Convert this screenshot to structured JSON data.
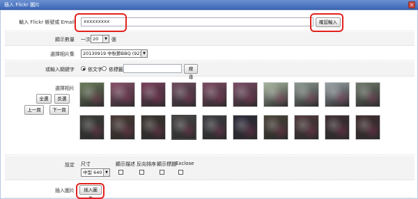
{
  "window": {
    "title": "插入 Flickr 圖片",
    "close_glyph": "×"
  },
  "account": {
    "label": "輸入 Flickr 帳號或 Email",
    "value": "xxxxxxxxx",
    "confirm_label": "確認輸入"
  },
  "count": {
    "label": "顯示數量",
    "prefix": "一次",
    "value": "20",
    "suffix": "張"
  },
  "album": {
    "label": "選擇相片集",
    "value": "20130919 中秋節BBQ (92)"
  },
  "keyword": {
    "label": "或輸入關鍵字",
    "option_full": "依文字",
    "option_tag": "依標籤",
    "search_label": "搜尋",
    "selected": "依文字"
  },
  "photos": {
    "label": "選擇相片",
    "select_all": "全選",
    "invert": "反選",
    "prev": "上一頁",
    "next": "下一頁",
    "selected_index": 13,
    "thumbs": [
      {
        "tone": "#6b7b5a"
      },
      {
        "tone": "#8a4f6a"
      },
      {
        "tone": "#7a3e5b"
      },
      {
        "tone": "#6e4a5e"
      },
      {
        "tone": "#7d4a63"
      },
      {
        "tone": "#7b4b66"
      },
      {
        "tone": "#a9b7a0"
      },
      {
        "tone": "#8d9a92"
      },
      {
        "tone": "#9aa3a8"
      },
      {
        "tone": "#707a6c"
      },
      {
        "tone": "#3c3e3a"
      },
      {
        "tone": "#4a3a35"
      },
      {
        "tone": "#3b3430"
      },
      {
        "tone": "#4b4747"
      },
      {
        "tone": "#3f3d42"
      },
      {
        "tone": "#2d2a3a"
      },
      {
        "tone": "#4a4338"
      },
      {
        "tone": "#503a3d"
      },
      {
        "tone": "#3f2e33"
      },
      {
        "tone": "#422d30"
      }
    ]
  },
  "settings": {
    "label": "設定",
    "size_label": "尺寸",
    "size_value": "中型 640",
    "show_desc": "顯示描述",
    "reverse": "反向排序",
    "show_title": "顯示標題",
    "exclose": "Exclose"
  },
  "insert": {
    "label": "插入圖片",
    "button_label": "插入圖片"
  }
}
